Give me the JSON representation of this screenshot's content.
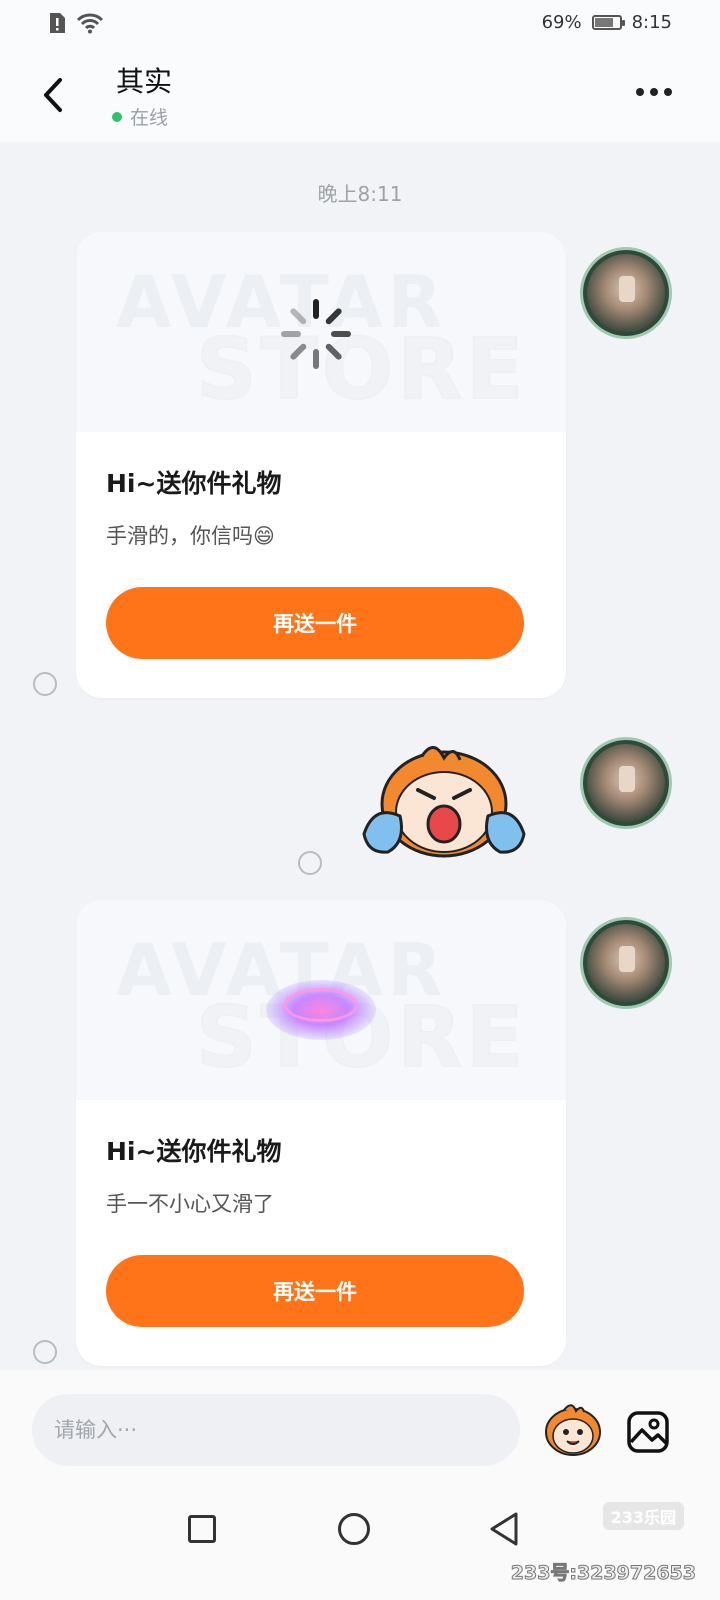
{
  "status_bar": {
    "battery": "69%",
    "battery_level": 0.69,
    "time": "8:15"
  },
  "header": {
    "title": "其实",
    "presence": "在线"
  },
  "timestamp": "晚上8:11",
  "messages": [
    {
      "watermark_top": "AVATAR",
      "watermark_bottom": "STORE",
      "title": "Hi~送你件礼物",
      "text": "手滑的，你信吗😄",
      "button": "再送一件"
    },
    {
      "sticker": "crying-mascot-sticker"
    },
    {
      "watermark_top": "AVATAR",
      "watermark_bottom": "STORE",
      "title": "Hi~送你件礼物",
      "text": "手一不小心又滑了",
      "button": "再送一件"
    }
  ],
  "input": {
    "placeholder": "请输入···"
  },
  "watermark": {
    "logo": "233乐园",
    "id_text": "233号:323972653"
  },
  "colors": {
    "accent": "#ff7418",
    "online": "#2ec26a",
    "background": "#f1f3f6"
  }
}
